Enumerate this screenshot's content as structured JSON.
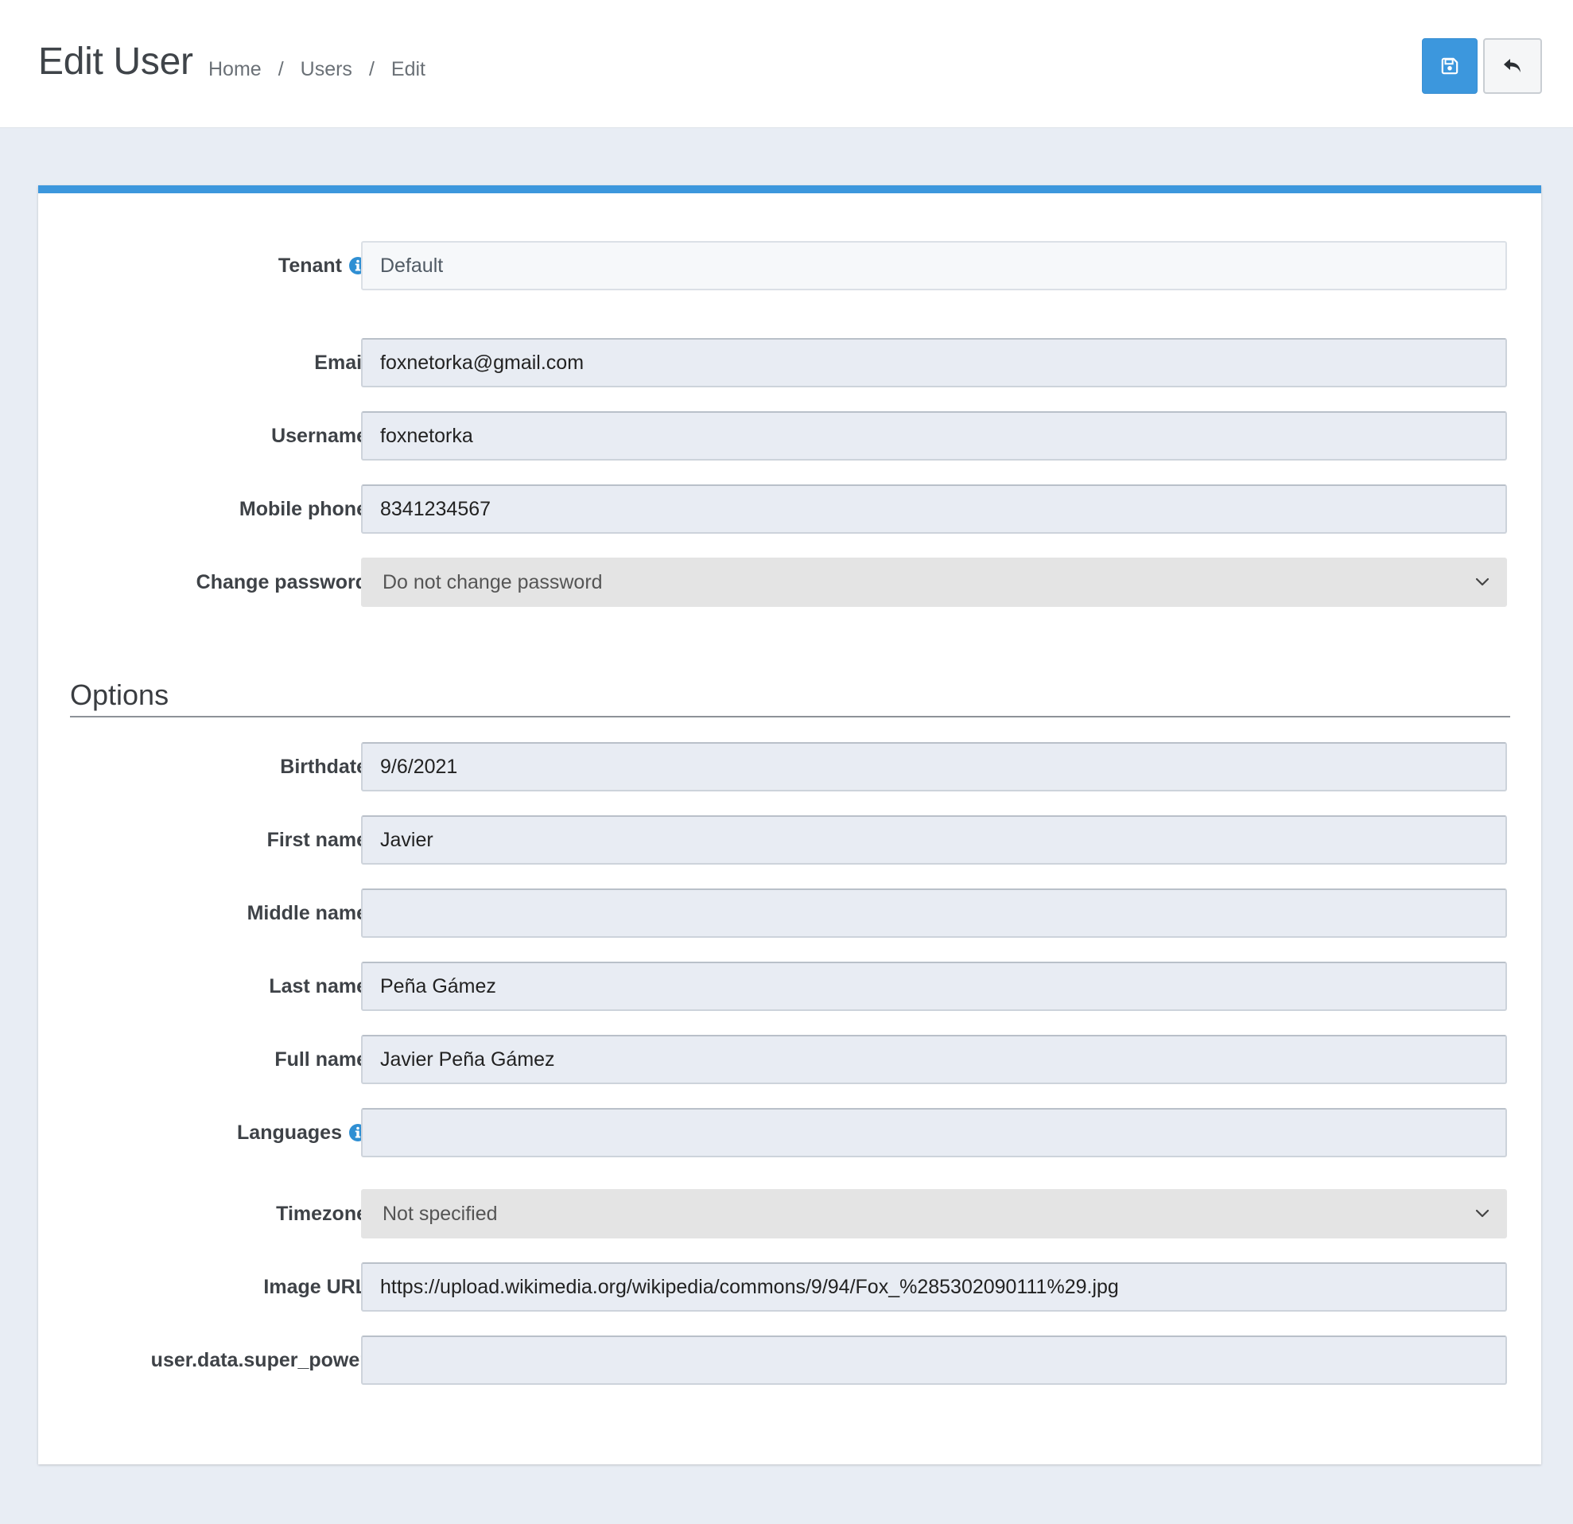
{
  "header": {
    "title": "Edit User",
    "breadcrumb": [
      "Home",
      "Users",
      "Edit"
    ],
    "separator": "/",
    "save_icon": "floppy-disk-icon",
    "back_icon": "reply-arrow-icon"
  },
  "colors": {
    "accent": "#3c97dd",
    "page_bg": "#e8edf4",
    "field_bg": "#e8ecf3",
    "select_bg": "#e4e4e4",
    "info_icon": "#2f8fd3"
  },
  "form": {
    "tenant": {
      "label": "Tenant",
      "value": "Default",
      "info_icon": "info-circle-icon"
    },
    "email": {
      "label": "Email",
      "value": "foxnetorka@gmail.com"
    },
    "username": {
      "label": "Username",
      "value": "foxnetorka"
    },
    "mobile_phone": {
      "label": "Mobile phone",
      "value": "8341234567"
    },
    "change_password": {
      "label": "Change password",
      "value": "Do not change password",
      "icon": "chevron-down-icon"
    }
  },
  "options": {
    "title": "Options",
    "birthdate": {
      "label": "Birthdate",
      "value": "9/6/2021"
    },
    "first_name": {
      "label": "First name",
      "value": "Javier"
    },
    "middle_name": {
      "label": "Middle name",
      "value": ""
    },
    "last_name": {
      "label": "Last name",
      "value": "Peña Gámez"
    },
    "full_name": {
      "label": "Full name",
      "value": "Javier Peña Gámez"
    },
    "languages": {
      "label": "Languages",
      "value": "",
      "info_icon": "info-circle-icon"
    },
    "timezone": {
      "label": "Timezone",
      "value": "Not specified",
      "icon": "chevron-down-icon"
    },
    "image_url": {
      "label": "Image URL",
      "value": "https://upload.wikimedia.org/wikipedia/commons/9/94/Fox_%285302090111%29.jpg"
    },
    "super_power": {
      "label": "user.data.super_power",
      "value": ""
    }
  }
}
